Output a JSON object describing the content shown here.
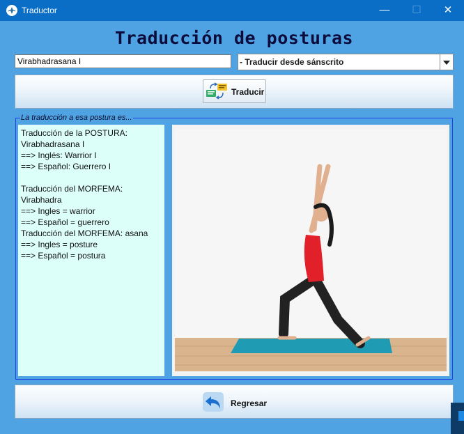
{
  "window": {
    "title": "Traductor",
    "minimize": "—",
    "maximize": "☐",
    "close": "✕",
    "icon": "app-logo-icon"
  },
  "heading": "Traducción de posturas",
  "search": {
    "value": "Virabhadrasana I"
  },
  "mode_select": {
    "value": "- Traducir desde sánscrito",
    "icon": "chevron-down-icon"
  },
  "translate_button": {
    "label": "Traducir",
    "icon": "translate-icon"
  },
  "result_group": {
    "legend": "La traducción a esa postura es..."
  },
  "result_text": [
    "Traducción de la POSTURA:",
    "Virabhadrasana I",
    "==> Inglés: Warrior I",
    "==> Español: Guerrero I",
    "",
    "Traducción del MORFEMA:",
    "Virabhadra",
    "==> Ingles = warrior",
    "==> Español = guerrero",
    "Traducción del MORFEMA: asana",
    "==> Ingles = posture",
    "==> Español = postura"
  ],
  "pose_image": {
    "subject": "woman-in-warrior-i-pose"
  },
  "back_button": {
    "label": "Regresar",
    "icon": "undo-arrow-icon"
  },
  "colors": {
    "background": "#4fa3e3",
    "titlebar": "#0a6dc6",
    "text_panel": "#ddfffa",
    "group_border": "#2340e6"
  }
}
